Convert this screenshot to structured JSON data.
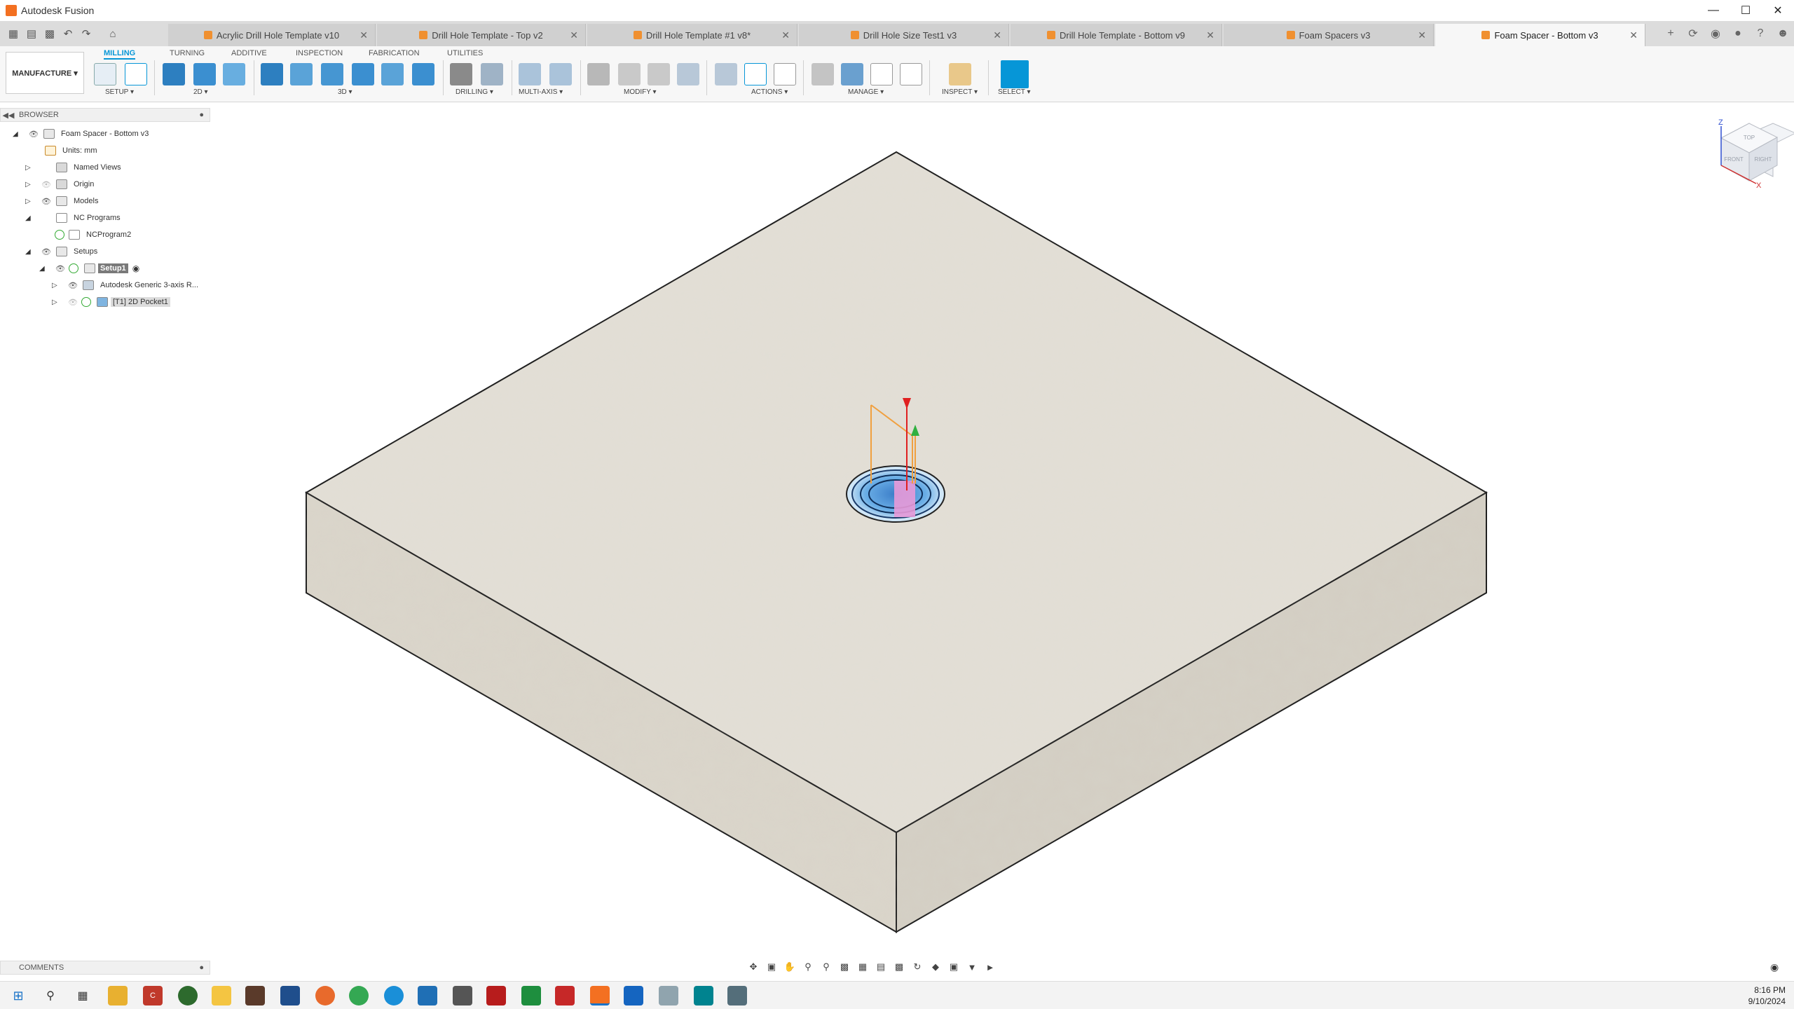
{
  "window": {
    "title": "Autodesk Fusion"
  },
  "tabs": [
    {
      "label": "Acrylic Drill Hole Template v10",
      "active": false
    },
    {
      "label": "Drill Hole Template - Top v2",
      "active": false
    },
    {
      "label": "Drill Hole Template #1 v8*",
      "active": false
    },
    {
      "label": "Drill Hole Size Test1 v3",
      "active": false
    },
    {
      "label": "Drill Hole Template - Bottom v9",
      "active": false
    },
    {
      "label": "Foam Spacers v3",
      "active": false
    },
    {
      "label": "Foam Spacer - Bottom v3",
      "active": true
    }
  ],
  "ribbon": {
    "workspace": "MANUFACTURE ▾",
    "tabs": [
      "MILLING",
      "TURNING",
      "ADDITIVE",
      "INSPECTION",
      "FABRICATION",
      "UTILITIES"
    ],
    "active_tab": "MILLING",
    "groups": [
      "SETUP ▾",
      "2D ▾",
      "3D ▾",
      "DRILLING ▾",
      "MULTI-AXIS ▾",
      "MODIFY ▾",
      "ACTIONS ▾",
      "MANAGE ▾",
      "INSPECT ▾",
      "SELECT ▾"
    ],
    "accent": "#0696d7"
  },
  "browser": {
    "header": "BROWSER",
    "items": [
      {
        "label": "Foam Spacer - Bottom v3"
      },
      {
        "label": "Units: mm"
      },
      {
        "label": "Named Views"
      },
      {
        "label": "Origin"
      },
      {
        "label": "Models"
      },
      {
        "label": "NC Programs"
      },
      {
        "label": "NCProgram2"
      },
      {
        "label": "Setups"
      },
      {
        "label": "Setup1"
      },
      {
        "label": "Autodesk Generic 3-axis R..."
      },
      {
        "label": "[T1] 2D Pocket1"
      }
    ]
  },
  "comments": {
    "label": "COMMENTS"
  },
  "viewcube": {
    "faces": [
      "TOP",
      "FRONT",
      "RIGHT"
    ],
    "axes": [
      "Z",
      "X"
    ]
  },
  "clock": {
    "time": "8:16 PM",
    "date": "9/10/2024"
  }
}
